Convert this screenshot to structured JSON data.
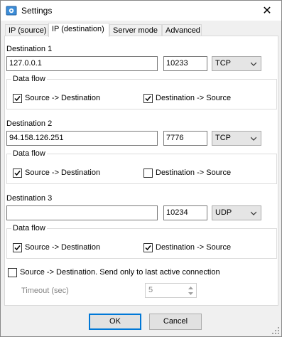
{
  "window": {
    "title": "Settings",
    "close_glyph": "✕"
  },
  "tabs": [
    {
      "label": "IP (source)",
      "active": false
    },
    {
      "label": "IP (destination)",
      "active": true
    },
    {
      "label": "Server mode",
      "active": false
    },
    {
      "label": "Advanced",
      "active": false
    }
  ],
  "destinations": [
    {
      "label": "Destination 1",
      "address": "127.0.0.1",
      "port": "10233",
      "protocol": "TCP",
      "data_flow": {
        "legend": "Data flow",
        "src_to_dst_label": "Source -> Destination",
        "src_to_dst_checked": true,
        "dst_to_src_label": "Destination -> Source",
        "dst_to_src_checked": true
      }
    },
    {
      "label": "Destination 2",
      "address": "94.158.126.251",
      "port": "7776",
      "protocol": "TCP",
      "data_flow": {
        "legend": "Data flow",
        "src_to_dst_label": "Source -> Destination",
        "src_to_dst_checked": true,
        "dst_to_src_label": "Destination -> Source",
        "dst_to_src_checked": false
      }
    },
    {
      "label": "Destination 3",
      "address": "",
      "port": "10234",
      "protocol": "UDP",
      "data_flow": {
        "legend": "Data flow",
        "src_to_dst_label": "Source -> Destination",
        "src_to_dst_checked": true,
        "dst_to_src_label": "Destination -> Source",
        "dst_to_src_checked": true
      }
    }
  ],
  "last_active": {
    "label": "Source -> Destination. Send only to last active connection",
    "checked": false,
    "timeout_label": "Timeout (sec)",
    "timeout_value": "5"
  },
  "buttons": {
    "ok": "OK",
    "cancel": "Cancel"
  },
  "colors": {
    "accent": "#0078d7",
    "check": "#000000"
  },
  "icons": {
    "app": "app-settings-icon",
    "combo_arrow": "chevron-down-icon",
    "check": "checkmark-icon"
  }
}
